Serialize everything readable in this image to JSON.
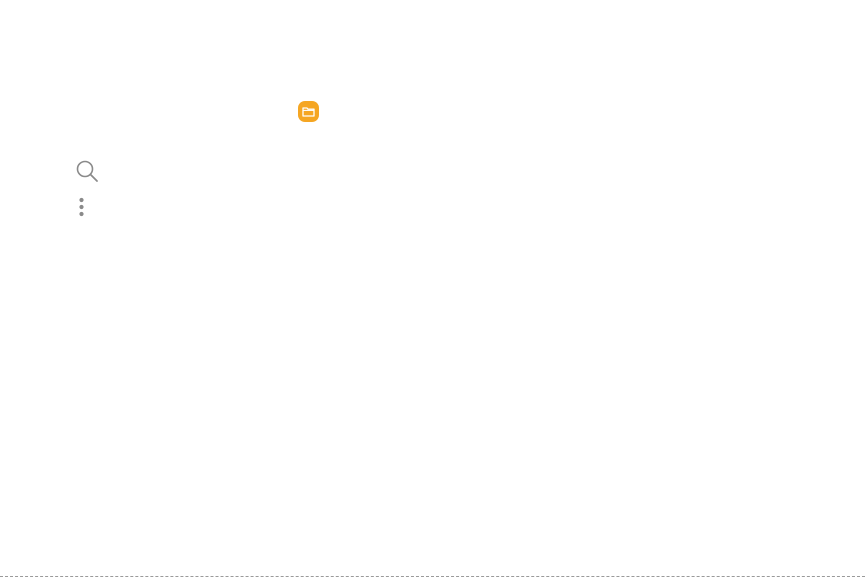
{
  "icons": {
    "app_icon": "folder-icon",
    "search": "search-icon",
    "more_options": "more-options-icon"
  },
  "colors": {
    "app_icon_bg": "#F5A623",
    "icon_glyph": "#8a8a8a"
  }
}
